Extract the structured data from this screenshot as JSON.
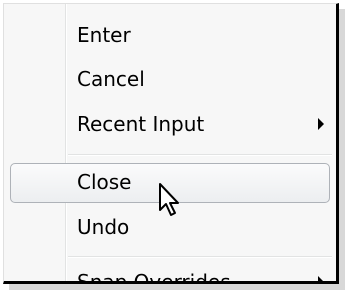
{
  "menu": {
    "items": [
      {
        "label": "Enter",
        "submenu": false
      },
      {
        "label": "Cancel",
        "submenu": false
      },
      {
        "label": "Recent Input",
        "submenu": true
      },
      {
        "label": "Close",
        "submenu": false,
        "highlighted": true
      },
      {
        "label": "Undo",
        "submenu": false
      },
      {
        "label": "Snap Overrides",
        "submenu": true
      }
    ]
  }
}
